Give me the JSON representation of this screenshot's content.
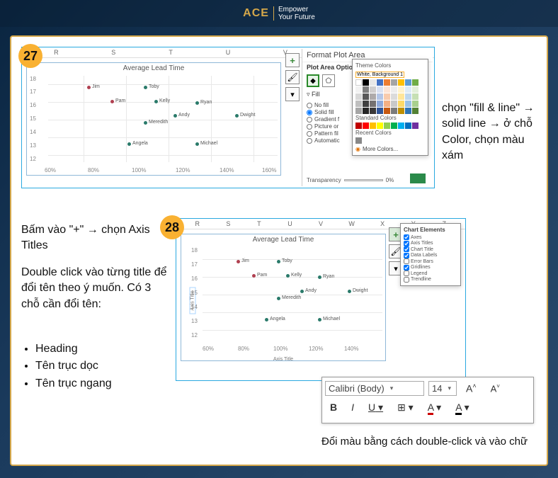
{
  "header": {
    "logo": "ACE",
    "tag1": "Empower",
    "tag2": "Your Future"
  },
  "step27": {
    "num": "27"
  },
  "step28": {
    "num": "28"
  },
  "text27": "chọn \"fill & line\" → solid line → ở chỗ Color, chọn màu xám",
  "text28a": "Bấm vào \"+\" → chọn Axis Titles",
  "text28b": "Double click vào từng title để đổi tên theo ý muốn. Có 3 chỗ cần đổi tên:",
  "text28list": [
    "Heading",
    "Tên trục dọc",
    "Tên trục ngang"
  ],
  "text28c": "Đổi màu bằng cách double-click và vào chữ",
  "excel_cols": [
    "R",
    "S",
    "T",
    "U",
    "V",
    "W",
    "X",
    "Y",
    "Z"
  ],
  "pane": {
    "title": "Format Plot Area",
    "sub": "Plot Area Optio",
    "section_fill": "Fill",
    "opts": [
      "No fill",
      "Solid fill",
      "Gradient f",
      "Picture or",
      "Pattern fil",
      "Automatic"
    ],
    "selected_opt": 1,
    "theme": "Theme Colors",
    "standard": "Standard Colors",
    "recent": "Recent Colors",
    "more": "More Colors...",
    "tooltip": "White, Background 1",
    "transp": "Transparency",
    "transp_val": "0%"
  },
  "chart_elements": {
    "title": "Chart Elements",
    "items": [
      "Axes",
      "Axis Titles",
      "Chart Title",
      "Data Labels",
      "Error Bars",
      "Gridlines",
      "Legend",
      "Trendline"
    ],
    "checked": [
      0,
      1,
      2,
      3,
      5
    ]
  },
  "font_bar": {
    "font": "Calibri (Body)",
    "size": "14",
    "inc": "A",
    "dec": "A",
    "b": "B",
    "i": "I",
    "u": "U"
  },
  "chart_data": {
    "type": "scatter",
    "title": "Average Lead Time",
    "xlabel": "Axis Title",
    "ylabel": "Axis Title",
    "xlim": [
      60,
      160
    ],
    "ylim": [
      12,
      18
    ],
    "xticks": [
      "60%",
      "80%",
      "100%",
      "120%",
      "140%",
      "160%"
    ],
    "yticks": [
      "12",
      "13",
      "14",
      "15",
      "16",
      "17",
      "18"
    ],
    "points": [
      {
        "name": "Jim",
        "x": 80,
        "y": 17,
        "c": "#b04050"
      },
      {
        "name": "Pam",
        "x": 90,
        "y": 16,
        "c": "#b04050"
      },
      {
        "name": "Toby",
        "x": 105,
        "y": 17,
        "c": "#2a7a6a"
      },
      {
        "name": "Kelly",
        "x": 110,
        "y": 16,
        "c": "#2a7a6a"
      },
      {
        "name": "Ryan",
        "x": 128,
        "y": 16,
        "c": "#2a7a6a"
      },
      {
        "name": "Meredith",
        "x": 105,
        "y": 14.5,
        "c": "#2a7a6a"
      },
      {
        "name": "Andy",
        "x": 118,
        "y": 15,
        "c": "#2a7a6a"
      },
      {
        "name": "Dwight",
        "x": 145,
        "y": 15,
        "c": "#2a7a6a"
      },
      {
        "name": "Angela",
        "x": 98,
        "y": 13,
        "c": "#2a7a6a"
      },
      {
        "name": "Michael",
        "x": 128,
        "y": 13,
        "c": "#2a7a6a"
      }
    ]
  }
}
